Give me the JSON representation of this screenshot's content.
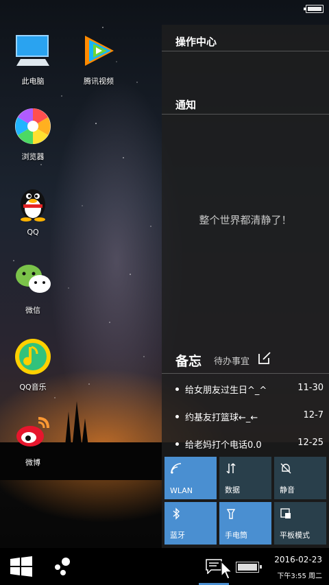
{
  "desktop": {
    "icons": [
      {
        "label": "此电脑",
        "icon": "computer-icon"
      },
      {
        "label": "腾讯视频",
        "icon": "tencent-video-icon"
      },
      {
        "label": "浏览器",
        "icon": "browser-icon"
      },
      {
        "label": "QQ",
        "icon": "qq-penguin-icon"
      },
      {
        "label": "微信",
        "icon": "wechat-icon"
      },
      {
        "label": "QQ音乐",
        "icon": "qq-music-icon"
      },
      {
        "label": "微博",
        "icon": "weibo-icon"
      }
    ]
  },
  "action_center": {
    "title": "操作中心",
    "notifications_label": "通知",
    "empty_message": "整个世界都清静了！",
    "memo": {
      "title": "备忘",
      "subtitle": "待办事宜",
      "items": [
        {
          "text": "给女朋友过生日^_^",
          "date": "11-30"
        },
        {
          "text": "约基友打篮球←_←",
          "date": "12-7"
        },
        {
          "text": "给老妈打个电话0.0",
          "date": "12-25"
        }
      ]
    },
    "tiles": [
      {
        "label": "WLAN",
        "icon": "wifi-icon",
        "active": true
      },
      {
        "label": "数据",
        "icon": "data-arrows-icon",
        "active": false
      },
      {
        "label": "静音",
        "icon": "bell-mute-icon",
        "active": false
      },
      {
        "label": "蓝牙",
        "icon": "bluetooth-icon",
        "active": true
      },
      {
        "label": "手电筒",
        "icon": "flashlight-icon",
        "active": true
      },
      {
        "label": "平板模式",
        "icon": "tablet-mode-icon",
        "active": false
      }
    ]
  },
  "taskbar": {
    "date": "2016-02-23",
    "time": "下午3:55 周二"
  },
  "colors": {
    "accent": "#4a8fd1",
    "panel": "#1e1e1e",
    "taskbar": "#000000"
  }
}
